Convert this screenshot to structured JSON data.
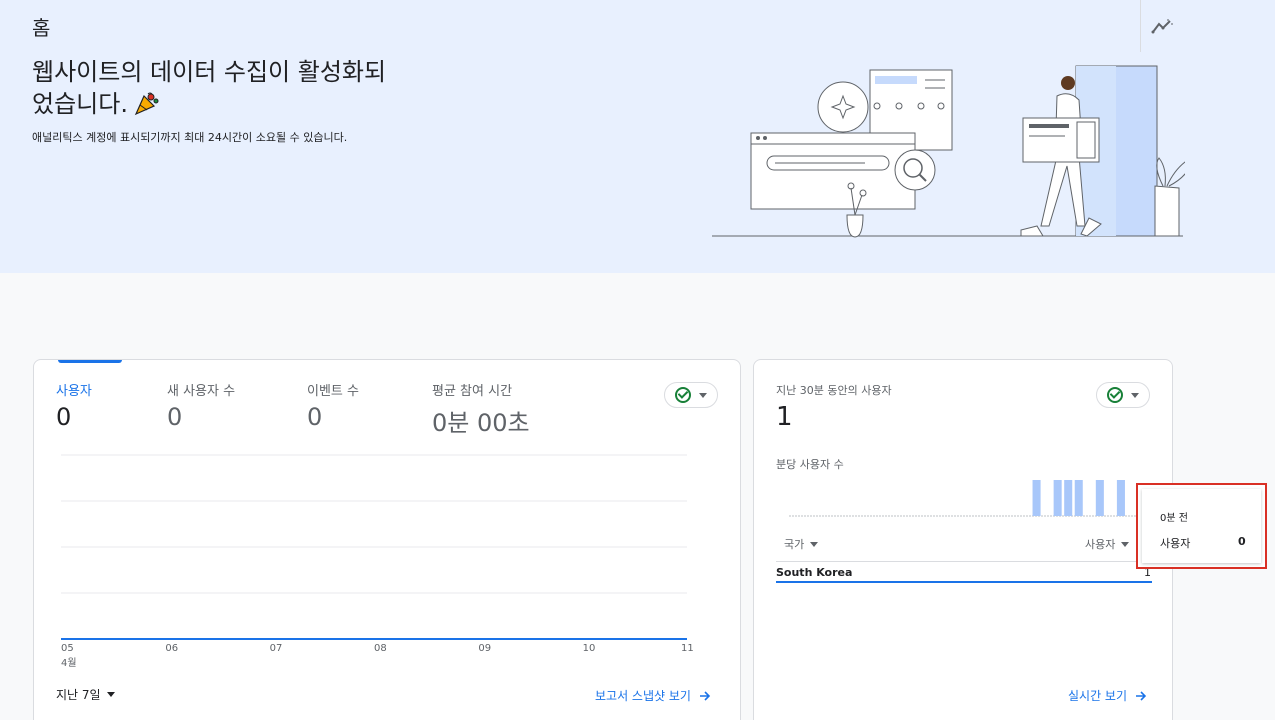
{
  "header": {
    "title": "홈",
    "trend_icon": "trending-icon"
  },
  "banner": {
    "headline_line1": "웹사이트의 데이터 수집이 활성화되",
    "headline_line2": "었습니다.",
    "celebrate_icon": "party-popper-icon",
    "subline": "애널리틱스 계정에 표시되기까지 최대 24시간이 소요될 수 있습니다."
  },
  "overview_card": {
    "metrics": [
      {
        "label": "사용자",
        "value": "0",
        "active": true
      },
      {
        "label": "새 사용자 수",
        "value": "0",
        "active": false
      },
      {
        "label": "이벤트 수",
        "value": "0",
        "active": false
      },
      {
        "label": "평균 참여 시간",
        "value": "0분 00초",
        "active": false
      }
    ],
    "date_range_label": "지난 7일",
    "snapshot_link": "보고서 스냅샷 보기",
    "month_label": "4월"
  },
  "chart_data": {
    "type": "line",
    "categories": [
      "05",
      "06",
      "07",
      "08",
      "09",
      "10",
      "11"
    ],
    "series": [
      {
        "values": [
          0,
          0,
          0,
          0,
          0,
          0,
          0
        ]
      }
    ],
    "xlabel": "",
    "ylabel": "",
    "grid": true
  },
  "realtime_card": {
    "title": "지난 30분 동안의 사용자",
    "value": "1",
    "per_minute_label": "분당 사용자 수",
    "bars": [
      0,
      0,
      0,
      0,
      0,
      0,
      0,
      0,
      0,
      0,
      0,
      0,
      0,
      0,
      0,
      0,
      0,
      0,
      0,
      0,
      0,
      0,
      0,
      1,
      0,
      1,
      1,
      1,
      0,
      1,
      0,
      1,
      0
    ],
    "dimension_header": "국가",
    "metric_header": "사용자",
    "rows": [
      {
        "name": "South Korea",
        "value": "1"
      }
    ],
    "realtime_link": "실시간 보기"
  },
  "tooltip": {
    "time": "0분 전",
    "label": "사용자",
    "value": "0"
  },
  "colors": {
    "accent": "#1a73e8",
    "bar": "#a8c7fa",
    "banner_bg": "#e8f0fe",
    "success": "#188038",
    "highlight_border": "#d93025"
  }
}
